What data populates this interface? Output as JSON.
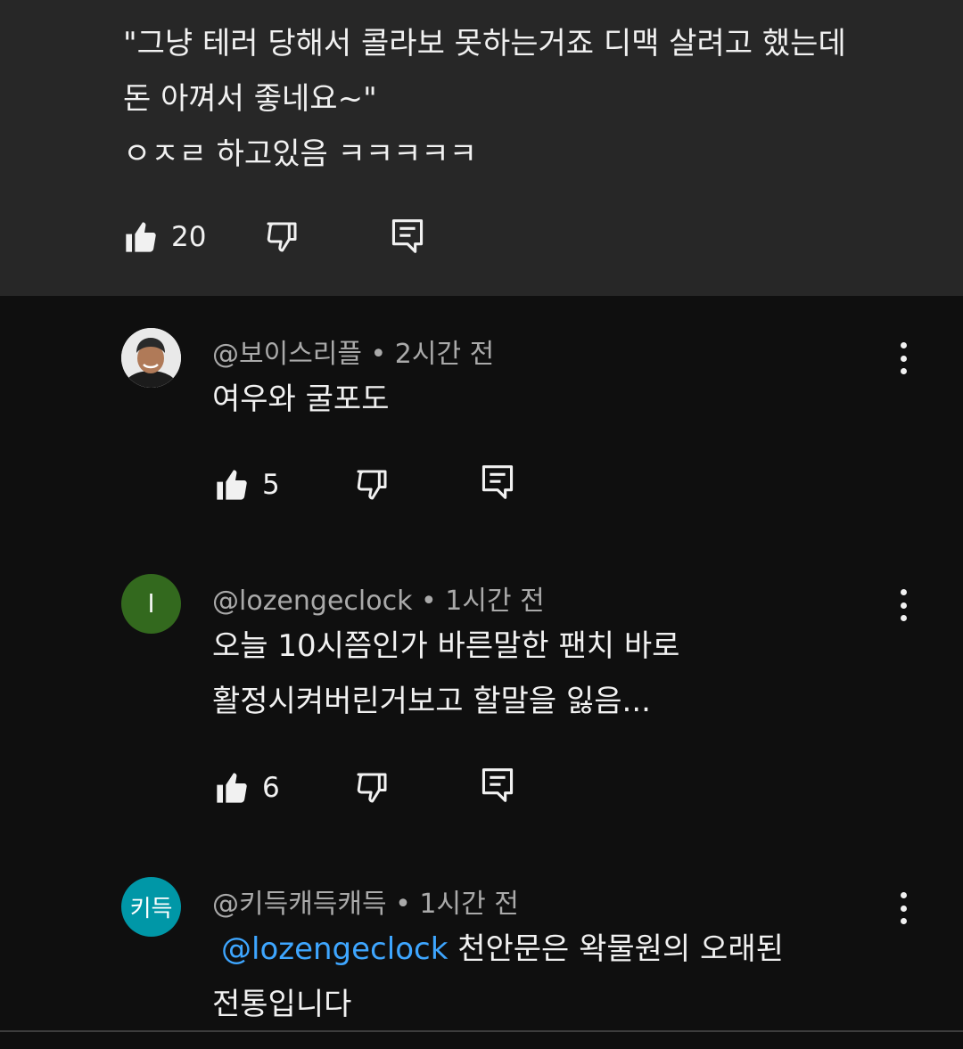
{
  "highlighted_comment": {
    "text": "\"그냥 테러 당해서 콜라보 못하는거죠 디맥 살려고 했는데\n돈 아껴서 좋네요~\"\nㅇㅈㄹ 하고있음 ㅋㅋㅋㅋㅋ",
    "like_count": "20"
  },
  "comments": [
    {
      "author": "@보이스리플",
      "time": "2시간 전",
      "text": "여우와 굴포도",
      "like_count": "5",
      "avatar_letter": "",
      "avatar_color": "#cfcfcf"
    },
    {
      "author": "@lozengeclock",
      "time": "1시간 전",
      "text": "오늘 10시쯤인가 바른말한 팬치 바로\n활정시켜버린거보고 할말을 잃음...",
      "like_count": "6",
      "avatar_letter": "l",
      "avatar_color": "#33691e"
    },
    {
      "author": "@키득캐득캐득",
      "time": "1시간 전",
      "mention": "@lozengeclock",
      "text_line1": " 천안문은 왁물원의 오래된",
      "text_line2": "전통입니다",
      "avatar_letter": "키득",
      "avatar_color": "#0097a7"
    }
  ],
  "separator": "•",
  "colors": {
    "background": "#0f0f0f",
    "highlight_bg": "#272727",
    "meta_text": "#aaaaaa",
    "mention": "#3ea6ff"
  },
  "icons": [
    "like-icon",
    "dislike-icon",
    "reply-icon",
    "more-options-icon"
  ]
}
